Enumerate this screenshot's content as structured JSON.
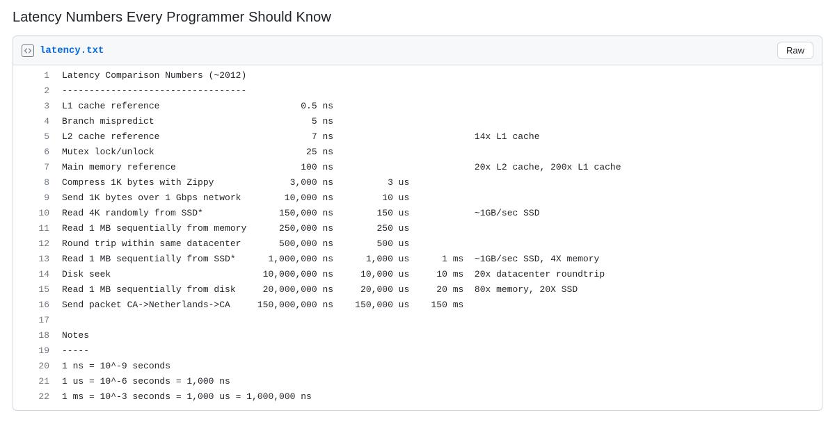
{
  "title": "Latency Numbers Every Programmer Should Know",
  "file": {
    "name": "latency.txt",
    "raw_button": "Raw"
  },
  "columns": {
    "desc_width": 36,
    "ns_width": 11,
    "us_width": 11,
    "ms_width": 7
  },
  "lines": [
    {
      "n": 1,
      "type": "plain",
      "text": "Latency Comparison Numbers (~2012)"
    },
    {
      "n": 2,
      "type": "plain",
      "text": "----------------------------------"
    },
    {
      "n": 3,
      "type": "row",
      "desc": "L1 cache reference",
      "ns": "0.5",
      "ns_unit": "ns"
    },
    {
      "n": 4,
      "type": "row",
      "desc": "Branch mispredict",
      "ns": "5",
      "ns_unit": "ns"
    },
    {
      "n": 5,
      "type": "row",
      "desc": "L2 cache reference",
      "ns": "7",
      "ns_unit": "ns",
      "note": "14x L1 cache",
      "note_after": "ms"
    },
    {
      "n": 6,
      "type": "row",
      "desc": "Mutex lock/unlock",
      "ns": "25",
      "ns_unit": "ns"
    },
    {
      "n": 7,
      "type": "row",
      "desc": "Main memory reference",
      "ns": "100",
      "ns_unit": "ns",
      "note": "20x L2 cache, 200x L1 cache",
      "note_after": "ms"
    },
    {
      "n": 8,
      "type": "row",
      "desc": "Compress 1K bytes with Zippy",
      "ns": "3,000",
      "ns_unit": "ns",
      "us": "3",
      "us_unit": "us"
    },
    {
      "n": 9,
      "type": "row",
      "desc": "Send 1K bytes over 1 Gbps network",
      "ns": "10,000",
      "ns_unit": "ns",
      "us": "10",
      "us_unit": "us"
    },
    {
      "n": 10,
      "type": "row",
      "desc": "Read 4K randomly from SSD*",
      "ns": "150,000",
      "ns_unit": "ns",
      "us": "150",
      "us_unit": "us",
      "note": "~1GB/sec SSD",
      "note_after": "ms"
    },
    {
      "n": 11,
      "type": "row",
      "desc": "Read 1 MB sequentially from memory",
      "ns": "250,000",
      "ns_unit": "ns",
      "us": "250",
      "us_unit": "us"
    },
    {
      "n": 12,
      "type": "row",
      "desc": "Round trip within same datacenter",
      "ns": "500,000",
      "ns_unit": "ns",
      "us": "500",
      "us_unit": "us"
    },
    {
      "n": 13,
      "type": "row",
      "desc": "Read 1 MB sequentially from SSD*",
      "ns": "1,000,000",
      "ns_unit": "ns",
      "us": "1,000",
      "us_unit": "us",
      "ms": "1",
      "ms_unit": "ms",
      "note": "~1GB/sec SSD, 4X memory"
    },
    {
      "n": 14,
      "type": "row",
      "desc": "Disk seek",
      "ns": "10,000,000",
      "ns_unit": "ns",
      "us": "10,000",
      "us_unit": "us",
      "ms": "10",
      "ms_unit": "ms",
      "note": "20x datacenter roundtrip"
    },
    {
      "n": 15,
      "type": "row",
      "desc": "Read 1 MB sequentially from disk",
      "ns": "20,000,000",
      "ns_unit": "ns",
      "us": "20,000",
      "us_unit": "us",
      "ms": "20",
      "ms_unit": "ms",
      "note": "80x memory, 20X SSD"
    },
    {
      "n": 16,
      "type": "row",
      "desc": "Send packet CA->Netherlands->CA",
      "ns": "150,000,000",
      "ns_unit": "ns",
      "us": "150,000",
      "us_unit": "us",
      "ms": "150",
      "ms_unit": "ms"
    },
    {
      "n": 17,
      "type": "plain",
      "text": ""
    },
    {
      "n": 18,
      "type": "plain",
      "text": "Notes"
    },
    {
      "n": 19,
      "type": "plain",
      "text": "-----"
    },
    {
      "n": 20,
      "type": "plain",
      "text": "1 ns = 10^-9 seconds"
    },
    {
      "n": 21,
      "type": "plain",
      "text": "1 us = 10^-6 seconds = 1,000 ns"
    },
    {
      "n": 22,
      "type": "plain",
      "text": "1 ms = 10^-3 seconds = 1,000 us = 1,000,000 ns"
    }
  ]
}
